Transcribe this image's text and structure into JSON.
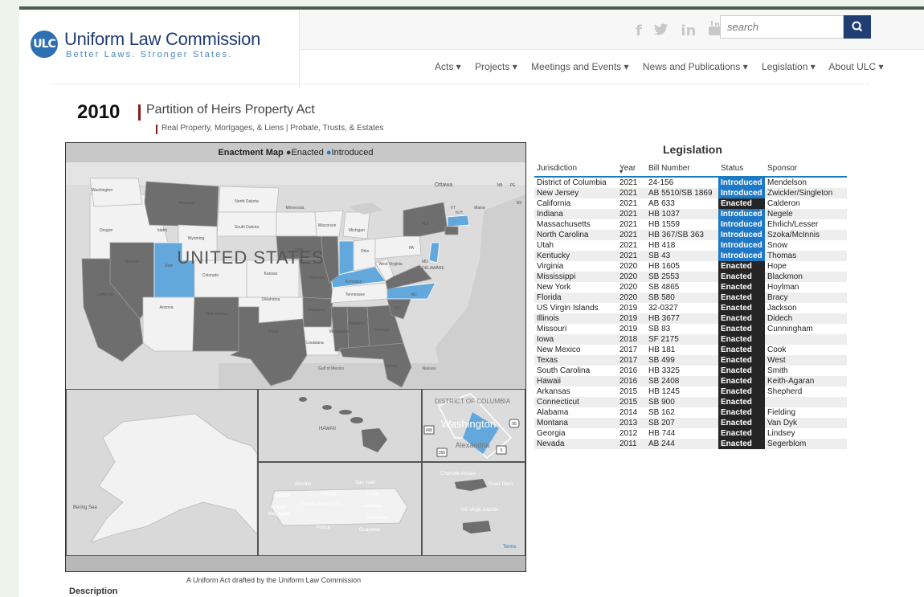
{
  "header": {
    "logo_mark": "ULC",
    "logo_title": "Uniform Law Commission",
    "logo_tagline": "Better Laws. Stronger States.",
    "search_placeholder": "search",
    "social_icons": [
      "facebook-icon",
      "twitter-icon",
      "linkedin-icon",
      "youtube-icon"
    ],
    "nav": [
      "Acts ▾",
      "Projects ▾",
      "Meetings and Events ▾",
      "News and Publications ▾",
      "Legislation ▾",
      "About ULC ▾"
    ]
  },
  "act": {
    "year": "2010",
    "title": "Partition of Heirs Property Act",
    "categories": "Real Property, Mortgages, & Liens | Probate, Trusts, & Estates"
  },
  "map": {
    "header_title": "Enactment Map",
    "legend_enacted": "Enacted",
    "legend_introduced": "Introduced",
    "country_label": "UNITED STATES",
    "labels": {
      "washington": "Washington",
      "montana": "Montana",
      "north_dakota": "North Dakota",
      "minnesota": "Minnesota",
      "oregon": "Oregon",
      "idaho": "Idaho",
      "wyoming": "Wyoming",
      "south_dakota": "South Dakota",
      "wisconsin": "Wisconsin",
      "michigan": "Michigan",
      "iowa": "Iowa",
      "nevada": "Nevada",
      "utah": "Utah",
      "colorado": "Colorado",
      "kansas": "Kansas",
      "missouri": "Missouri",
      "kentucky": "Kentucky",
      "ohio": "Ohio",
      "california": "California",
      "arizona": "Arizona",
      "new_mexico": "New Mexico",
      "oklahoma": "Oklahoma",
      "arkansas": "Arkansas",
      "tennessee": "Tennessee",
      "texas": "Texas",
      "louisiana": "Louisiana",
      "alabama": "Alabama",
      "georgia": "Georgia",
      "mississippi": "Mississippi",
      "florida": "Florida",
      "nc": "NC",
      "sc": "SC",
      "ny": "N.Y.",
      "pa": "PA",
      "vt": "VT",
      "nh": "N.H.",
      "maine": "Maine",
      "nb": "NB",
      "pe": "PE",
      "ns": "NS",
      "ottawa": "Ottawa",
      "west_virginia": "West Virginia",
      "md": "MD",
      "delaware": "DELAWARE",
      "gulf": "Gulf of Mexico",
      "nassau": "Nassau",
      "hawaii": "HAWAII",
      "bering_sea": "Bering Sea",
      "dc_label": "DISTRICT OF COLUMBIA",
      "dc_city": "Washington",
      "alexandria": "Alexandria",
      "arecibo": "Arecibo",
      "san_juan": "San Juan",
      "aguada": "Aguada",
      "florida_pr": "Florida",
      "loiza": "Loiza",
      "rincon": "Rincon",
      "puerto_rico": "Puerto Rico (U.S.)",
      "carolina": "Carolina",
      "mayaguez": "Mayagüez",
      "maunabo": "Maunabo",
      "ponce": "Ponce",
      "guayama": "Guayama",
      "charlotte_amalie": "Charlotte Amalie",
      "road_town": "Road Town",
      "us_virgin": "US Virgin Islands",
      "terms": "Terms",
      "shield_495": "495",
      "shield_95": "95",
      "shield_395": "395",
      "shield_5": "5"
    },
    "colors": {
      "enacted": "#6e6e6e",
      "introduced": "#63a8dc",
      "base": "#f2f2f2",
      "land": "#dcdcdc"
    }
  },
  "legislation": {
    "title": "Legislation",
    "columns": [
      "Jurisdiction",
      "Year",
      "Bill Number",
      "Status",
      "Sponsor"
    ],
    "sort_indicator": "▾",
    "rows": [
      {
        "jurisdiction": "District of Columbia",
        "year": "2021",
        "bill": "24-156",
        "status": "Introduced",
        "sponsor": "Mendelson"
      },
      {
        "jurisdiction": "New Jersey",
        "year": "2021",
        "bill": "AB 5510/SB 1869",
        "status": "Introduced",
        "sponsor": "Zwickler/Singleton"
      },
      {
        "jurisdiction": "California",
        "year": "2021",
        "bill": "AB 633",
        "status": "Enacted",
        "sponsor": "Calderon"
      },
      {
        "jurisdiction": "Indiana",
        "year": "2021",
        "bill": "HB 1037",
        "status": "Introduced",
        "sponsor": "Negele"
      },
      {
        "jurisdiction": "Massachusetts",
        "year": "2021",
        "bill": "HB 1559",
        "status": "Introduced",
        "sponsor": "Ehrlich/Lesser"
      },
      {
        "jurisdiction": "North Carolina",
        "year": "2021",
        "bill": "HB 367/SB 363",
        "status": "Introduced",
        "sponsor": "Szoka/McInnis"
      },
      {
        "jurisdiction": "Utah",
        "year": "2021",
        "bill": "HB 418",
        "status": "Introduced",
        "sponsor": "Snow"
      },
      {
        "jurisdiction": "Kentucky",
        "year": "2021",
        "bill": "SB 43",
        "status": "Introduced",
        "sponsor": "Thomas"
      },
      {
        "jurisdiction": "Virginia",
        "year": "2020",
        "bill": "HB 1605",
        "status": "Enacted",
        "sponsor": "Hope"
      },
      {
        "jurisdiction": "Mississippi",
        "year": "2020",
        "bill": "SB 2553",
        "status": "Enacted",
        "sponsor": "Blackmon"
      },
      {
        "jurisdiction": "New York",
        "year": "2020",
        "bill": "SB 4865",
        "status": "Enacted",
        "sponsor": "Hoylman"
      },
      {
        "jurisdiction": "Florida",
        "year": "2020",
        "bill": "SB 580",
        "status": "Enacted",
        "sponsor": "Bracy"
      },
      {
        "jurisdiction": "US Virgin Islands",
        "year": "2019",
        "bill": "32-0327",
        "status": "Enacted",
        "sponsor": "Jackson"
      },
      {
        "jurisdiction": "Illinois",
        "year": "2019",
        "bill": "HB 3677",
        "status": "Enacted",
        "sponsor": "Didech"
      },
      {
        "jurisdiction": "Missouri",
        "year": "2019",
        "bill": "SB 83",
        "status": "Enacted",
        "sponsor": "Cunningham"
      },
      {
        "jurisdiction": "Iowa",
        "year": "2018",
        "bill": "SF 2175",
        "status": "Enacted",
        "sponsor": ""
      },
      {
        "jurisdiction": "New Mexico",
        "year": "2017",
        "bill": "HB 181",
        "status": "Enacted",
        "sponsor": "Cook"
      },
      {
        "jurisdiction": "Texas",
        "year": "2017",
        "bill": "SB 499",
        "status": "Enacted",
        "sponsor": "West"
      },
      {
        "jurisdiction": "South Carolina",
        "year": "2016",
        "bill": "HB 3325",
        "status": "Enacted",
        "sponsor": "Smith"
      },
      {
        "jurisdiction": "Hawaii",
        "year": "2016",
        "bill": "SB 2408",
        "status": "Enacted",
        "sponsor": "Keith-Agaran"
      },
      {
        "jurisdiction": "Arkansas",
        "year": "2015",
        "bill": "HB 1245",
        "status": "Enacted",
        "sponsor": "Shepherd"
      },
      {
        "jurisdiction": "Connecticut",
        "year": "2015",
        "bill": "SB 900",
        "status": "Enacted",
        "sponsor": ""
      },
      {
        "jurisdiction": "Alabama",
        "year": "2014",
        "bill": "SB 162",
        "status": "Enacted",
        "sponsor": "Fielding"
      },
      {
        "jurisdiction": "Montana",
        "year": "2013",
        "bill": "SB 207",
        "status": "Enacted",
        "sponsor": "Van Dyk"
      },
      {
        "jurisdiction": "Georgia",
        "year": "2012",
        "bill": "HB 744",
        "status": "Enacted",
        "sponsor": "Lindsey"
      },
      {
        "jurisdiction": "Nevada",
        "year": "2011",
        "bill": "AB 244",
        "status": "Enacted",
        "sponsor": "Segerblom"
      }
    ]
  },
  "footer": {
    "caption": "A Uniform Act drafted by the Uniform Law Commission",
    "description_heading": "Description"
  }
}
